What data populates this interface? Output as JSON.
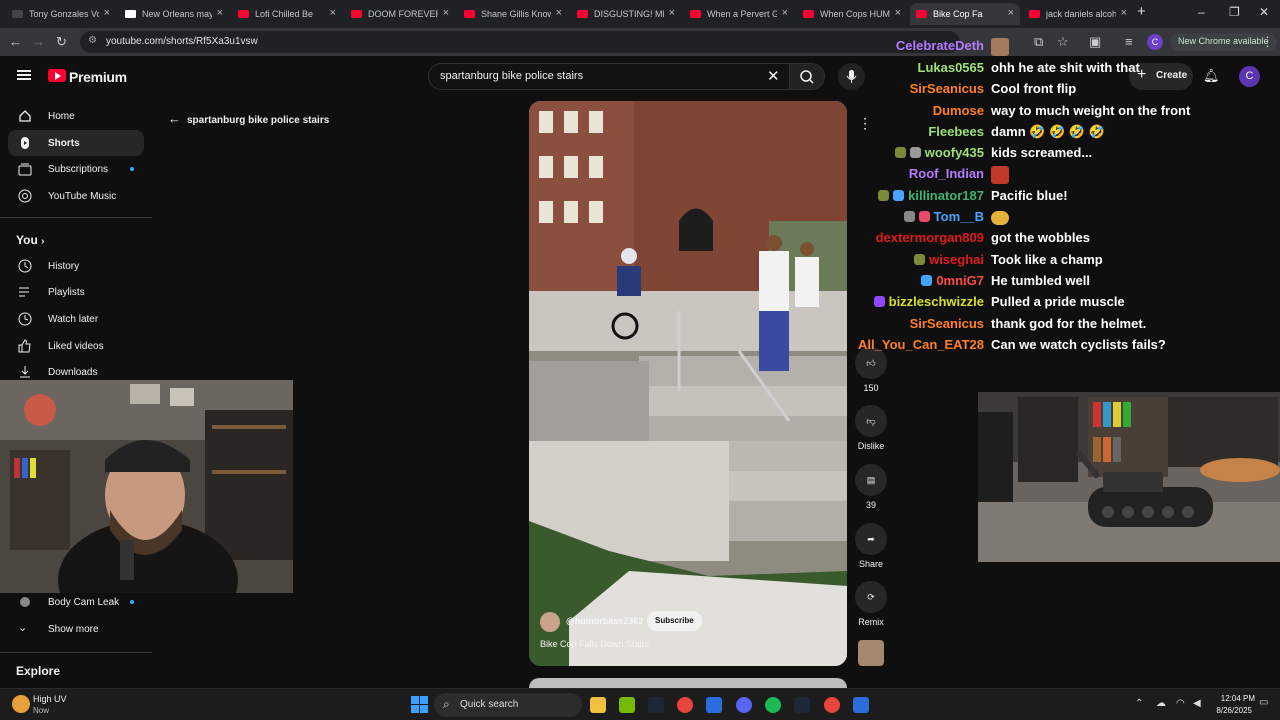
{
  "browser": {
    "tabs": [
      {
        "title": "Tony Gonzales Vo",
        "type": "nyt-dark"
      },
      {
        "title": "New Orleans mayo",
        "type": "nyt"
      },
      {
        "title": "Lofi Chilled Be",
        "type": "yt"
      },
      {
        "title": "DOOM FOREVER |",
        "type": "yt"
      },
      {
        "title": "Shane Gillis Know",
        "type": "yt"
      },
      {
        "title": "DISGUSTING! MM",
        "type": "yt"
      },
      {
        "title": "When a Pervert Ge",
        "type": "yt"
      },
      {
        "title": "When Cops HUM",
        "type": "yt"
      },
      {
        "title": "Bike Cop Falls",
        "type": "yt"
      },
      {
        "title": "jack daniels alcoh",
        "type": "yt"
      }
    ],
    "url": "youtube.com/shorts/Rf5Xa3u1vsw",
    "new_chrome_label": "New Chrome available",
    "profile_initial": "C"
  },
  "youtube": {
    "logo_text": "Premium",
    "search_value": "spartanburg bike police stairs",
    "create_label": "Create",
    "avatar_initial": "C",
    "back_query": "spartanburg bike police stairs",
    "sidebar": {
      "home": "Home",
      "shorts": "Shorts",
      "subscriptions": "Subscriptions",
      "youtube_music": "YouTube Music",
      "you": "You",
      "history": "History",
      "playlists": "Playlists",
      "watch_later": "Watch later",
      "liked_videos": "Liked videos",
      "downloads": "Downloads",
      "body_cam_leak": "Body Cam Leak",
      "show_more": "Show more",
      "explore": "Explore"
    },
    "short": {
      "channel": "@humorbase2362",
      "subscribe": "Subscribe",
      "title": "Bike Cop Falls Down Stairs",
      "likes": "150",
      "dislike": "Dislike",
      "comments": "39",
      "share": "Share",
      "remix": "Remix"
    }
  },
  "chat": [
    {
      "user": "CelebrateDeth",
      "color": "#b57bff",
      "msg": ""
    },
    {
      "user": "Lukas0565",
      "color": "#9fe07a",
      "msg": "ohh he ate shit with that"
    },
    {
      "user": "SirSeanicus",
      "color": "#ff7f24",
      "msg": "Cool front flip"
    },
    {
      "user": "Dumose",
      "color": "#ff7f24",
      "msg": "way to much weight on the front"
    },
    {
      "user": "Fleebees",
      "color": "#9fe07a",
      "msg": "damn 🤣 🤣 🤣 🤣"
    },
    {
      "user": "woofy435",
      "color": "#9fe07a",
      "msg": "kids screamed..."
    },
    {
      "user": "Roof_Indian",
      "color": "#b57bff",
      "msg": ""
    },
    {
      "user": "killinator187",
      "color": "#3cb371",
      "msg": "Pacific blue!"
    },
    {
      "user": "Tom__B",
      "color": "#4aa3ff",
      "msg": ""
    },
    {
      "user": "dextermorgan809",
      "color": "#e01b1b",
      "msg": "got the wobbles"
    },
    {
      "user": "wiseghai",
      "color": "#e01b1b",
      "msg": "Took like a champ"
    },
    {
      "user": "0mniG7",
      "color": "#ff4a4a",
      "msg": "He tumbled well"
    },
    {
      "user": "bizzleschwizzle",
      "color": "#d6e02a",
      "msg": "Pulled a pride muscle"
    },
    {
      "user": "SirSeanicus",
      "color": "#ff7f24",
      "msg": "thank god for the helmet."
    },
    {
      "user": "All_You_Can_EAT28",
      "color": "#ff7f24",
      "msg": "Can we watch cyclists fails?"
    }
  ],
  "taskbar": {
    "weather_title": "High UV",
    "weather_sub": "Now",
    "search_placeholder": "Quick search",
    "time": "12:04 PM",
    "date": "8/26/2025"
  }
}
